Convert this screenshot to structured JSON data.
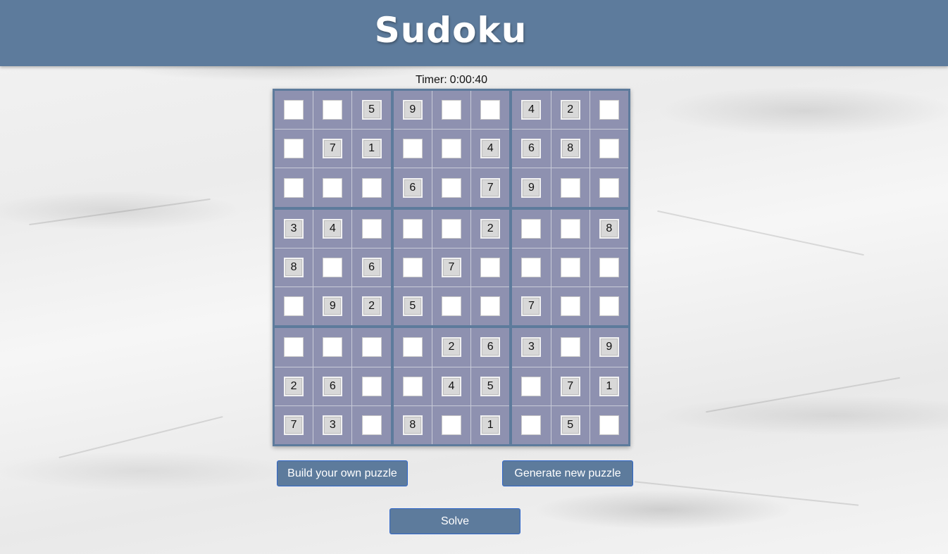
{
  "header": {
    "title": "Sudoku"
  },
  "timer": {
    "label": "Timer:",
    "value": "0:00:40"
  },
  "board": {
    "grid": [
      [
        "",
        "",
        "5",
        "9",
        "",
        "",
        "4",
        "2",
        ""
      ],
      [
        "",
        "7",
        "1",
        "",
        "",
        "4",
        "6",
        "8",
        ""
      ],
      [
        "",
        "",
        "",
        "6",
        "",
        "7",
        "9",
        "",
        ""
      ],
      [
        "3",
        "4",
        "",
        "",
        "",
        "2",
        "",
        "",
        "8"
      ],
      [
        "8",
        "",
        "6",
        "",
        "7",
        "",
        "",
        "",
        ""
      ],
      [
        "",
        "9",
        "2",
        "5",
        "",
        "",
        "7",
        "",
        ""
      ],
      [
        "",
        "",
        "",
        "",
        "2",
        "6",
        "3",
        "",
        "9"
      ],
      [
        "2",
        "6",
        "",
        "",
        "4",
        "5",
        "",
        "7",
        "1"
      ],
      [
        "7",
        "3",
        "",
        "8",
        "",
        "1",
        "",
        "5",
        ""
      ]
    ]
  },
  "actions": {
    "build_label": "Build your own puzzle",
    "generate_label": "Generate new puzzle",
    "solve_label": "Solve"
  },
  "colors": {
    "header_bg": "#5d7b9c",
    "board_border": "#5d7b9c",
    "cell_bg": "#8e91b0",
    "given_cell": "#d8d8d8",
    "empty_cell": "#ffffff",
    "button_border": "#2f66c8"
  }
}
